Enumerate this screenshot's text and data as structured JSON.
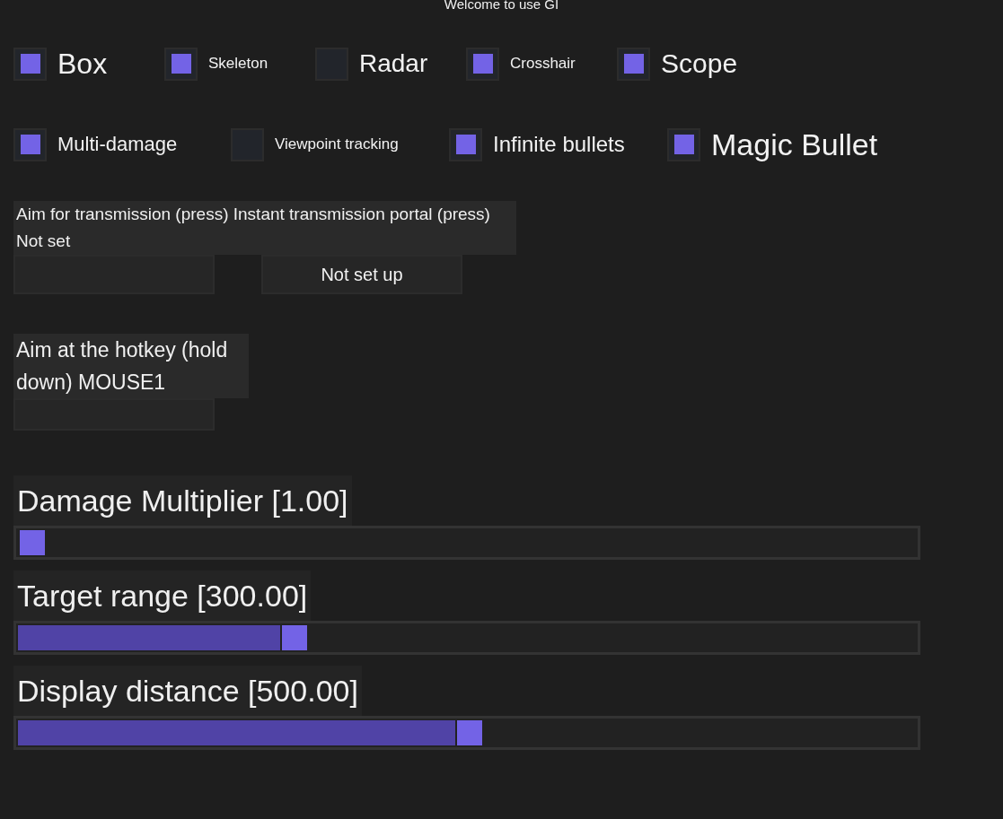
{
  "title": "Welcome to use GI",
  "checkbox_rows": [
    [
      {
        "label": "Box",
        "checked": true
      },
      {
        "label": "Skeleton",
        "checked": true
      },
      {
        "label": "Radar",
        "checked": false
      },
      {
        "label": "Crosshair",
        "checked": true
      },
      {
        "label": "Scope",
        "checked": true
      }
    ],
    [
      {
        "label": "Multi-damage",
        "checked": true
      },
      {
        "label": "Viewpoint tracking",
        "checked": false
      },
      {
        "label": "Infinite bullets",
        "checked": true
      },
      {
        "label": "Magic Bullet",
        "checked": true
      }
    ]
  ],
  "hotkeys": [
    {
      "label": "Aim for transmission (press) Instant transmission portal (press) Not set",
      "buttons": [
        {
          "kind": "blank"
        },
        {
          "kind": "text",
          "label": "Not set up"
        }
      ]
    },
    {
      "label": "Aim at the hotkey (hold down) MOUSE1",
      "buttons": [
        {
          "kind": "blank"
        }
      ]
    }
  ],
  "sliders": [
    {
      "label": "Damage Multiplier [1.00]",
      "level": 0
    },
    {
      "label": "Target range [300.00]",
      "level": 0.3
    },
    {
      "label": "Display distance [500.00]",
      "level": 0.5
    }
  ]
}
